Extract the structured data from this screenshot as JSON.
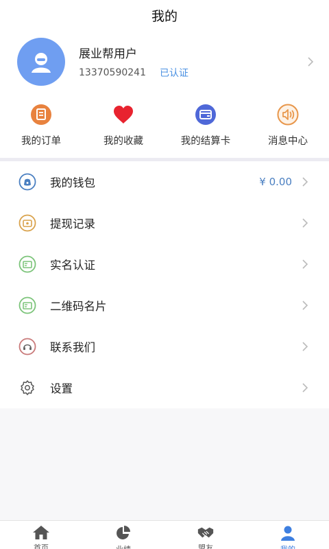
{
  "header": {
    "title": "我的"
  },
  "profile": {
    "name": "展业帮用户",
    "phone": "13370590241",
    "verified": "已认证"
  },
  "quick_actions": [
    {
      "label": "我的订单",
      "icon": "order-icon"
    },
    {
      "label": "我的收藏",
      "icon": "heart-icon"
    },
    {
      "label": "我的结算卡",
      "icon": "card-icon"
    },
    {
      "label": "消息中心",
      "icon": "speaker-icon"
    }
  ],
  "menu": [
    {
      "label": "我的钱包",
      "value": "¥ 0.00",
      "icon": "wallet-icon"
    },
    {
      "label": "提现记录",
      "icon": "withdraw-icon"
    },
    {
      "label": "实名认证",
      "icon": "id-card-icon"
    },
    {
      "label": "二维码名片",
      "icon": "qr-card-icon"
    },
    {
      "label": "联系我们",
      "icon": "headset-icon"
    },
    {
      "label": "设置",
      "icon": "gear-icon"
    }
  ],
  "tabbar": [
    {
      "label": "首页",
      "icon": "home-icon"
    },
    {
      "label": "业绩",
      "icon": "pie-chart-icon"
    },
    {
      "label": "盟友",
      "icon": "handshake-icon"
    },
    {
      "label": "我的",
      "icon": "user-icon"
    }
  ],
  "colors": {
    "accent": "#3e7fe0",
    "avatar": "#6f9ef1",
    "heart": "#e8232f",
    "order": "#e8823e",
    "card": "#4f68d8",
    "value": "#4a7fc1"
  }
}
